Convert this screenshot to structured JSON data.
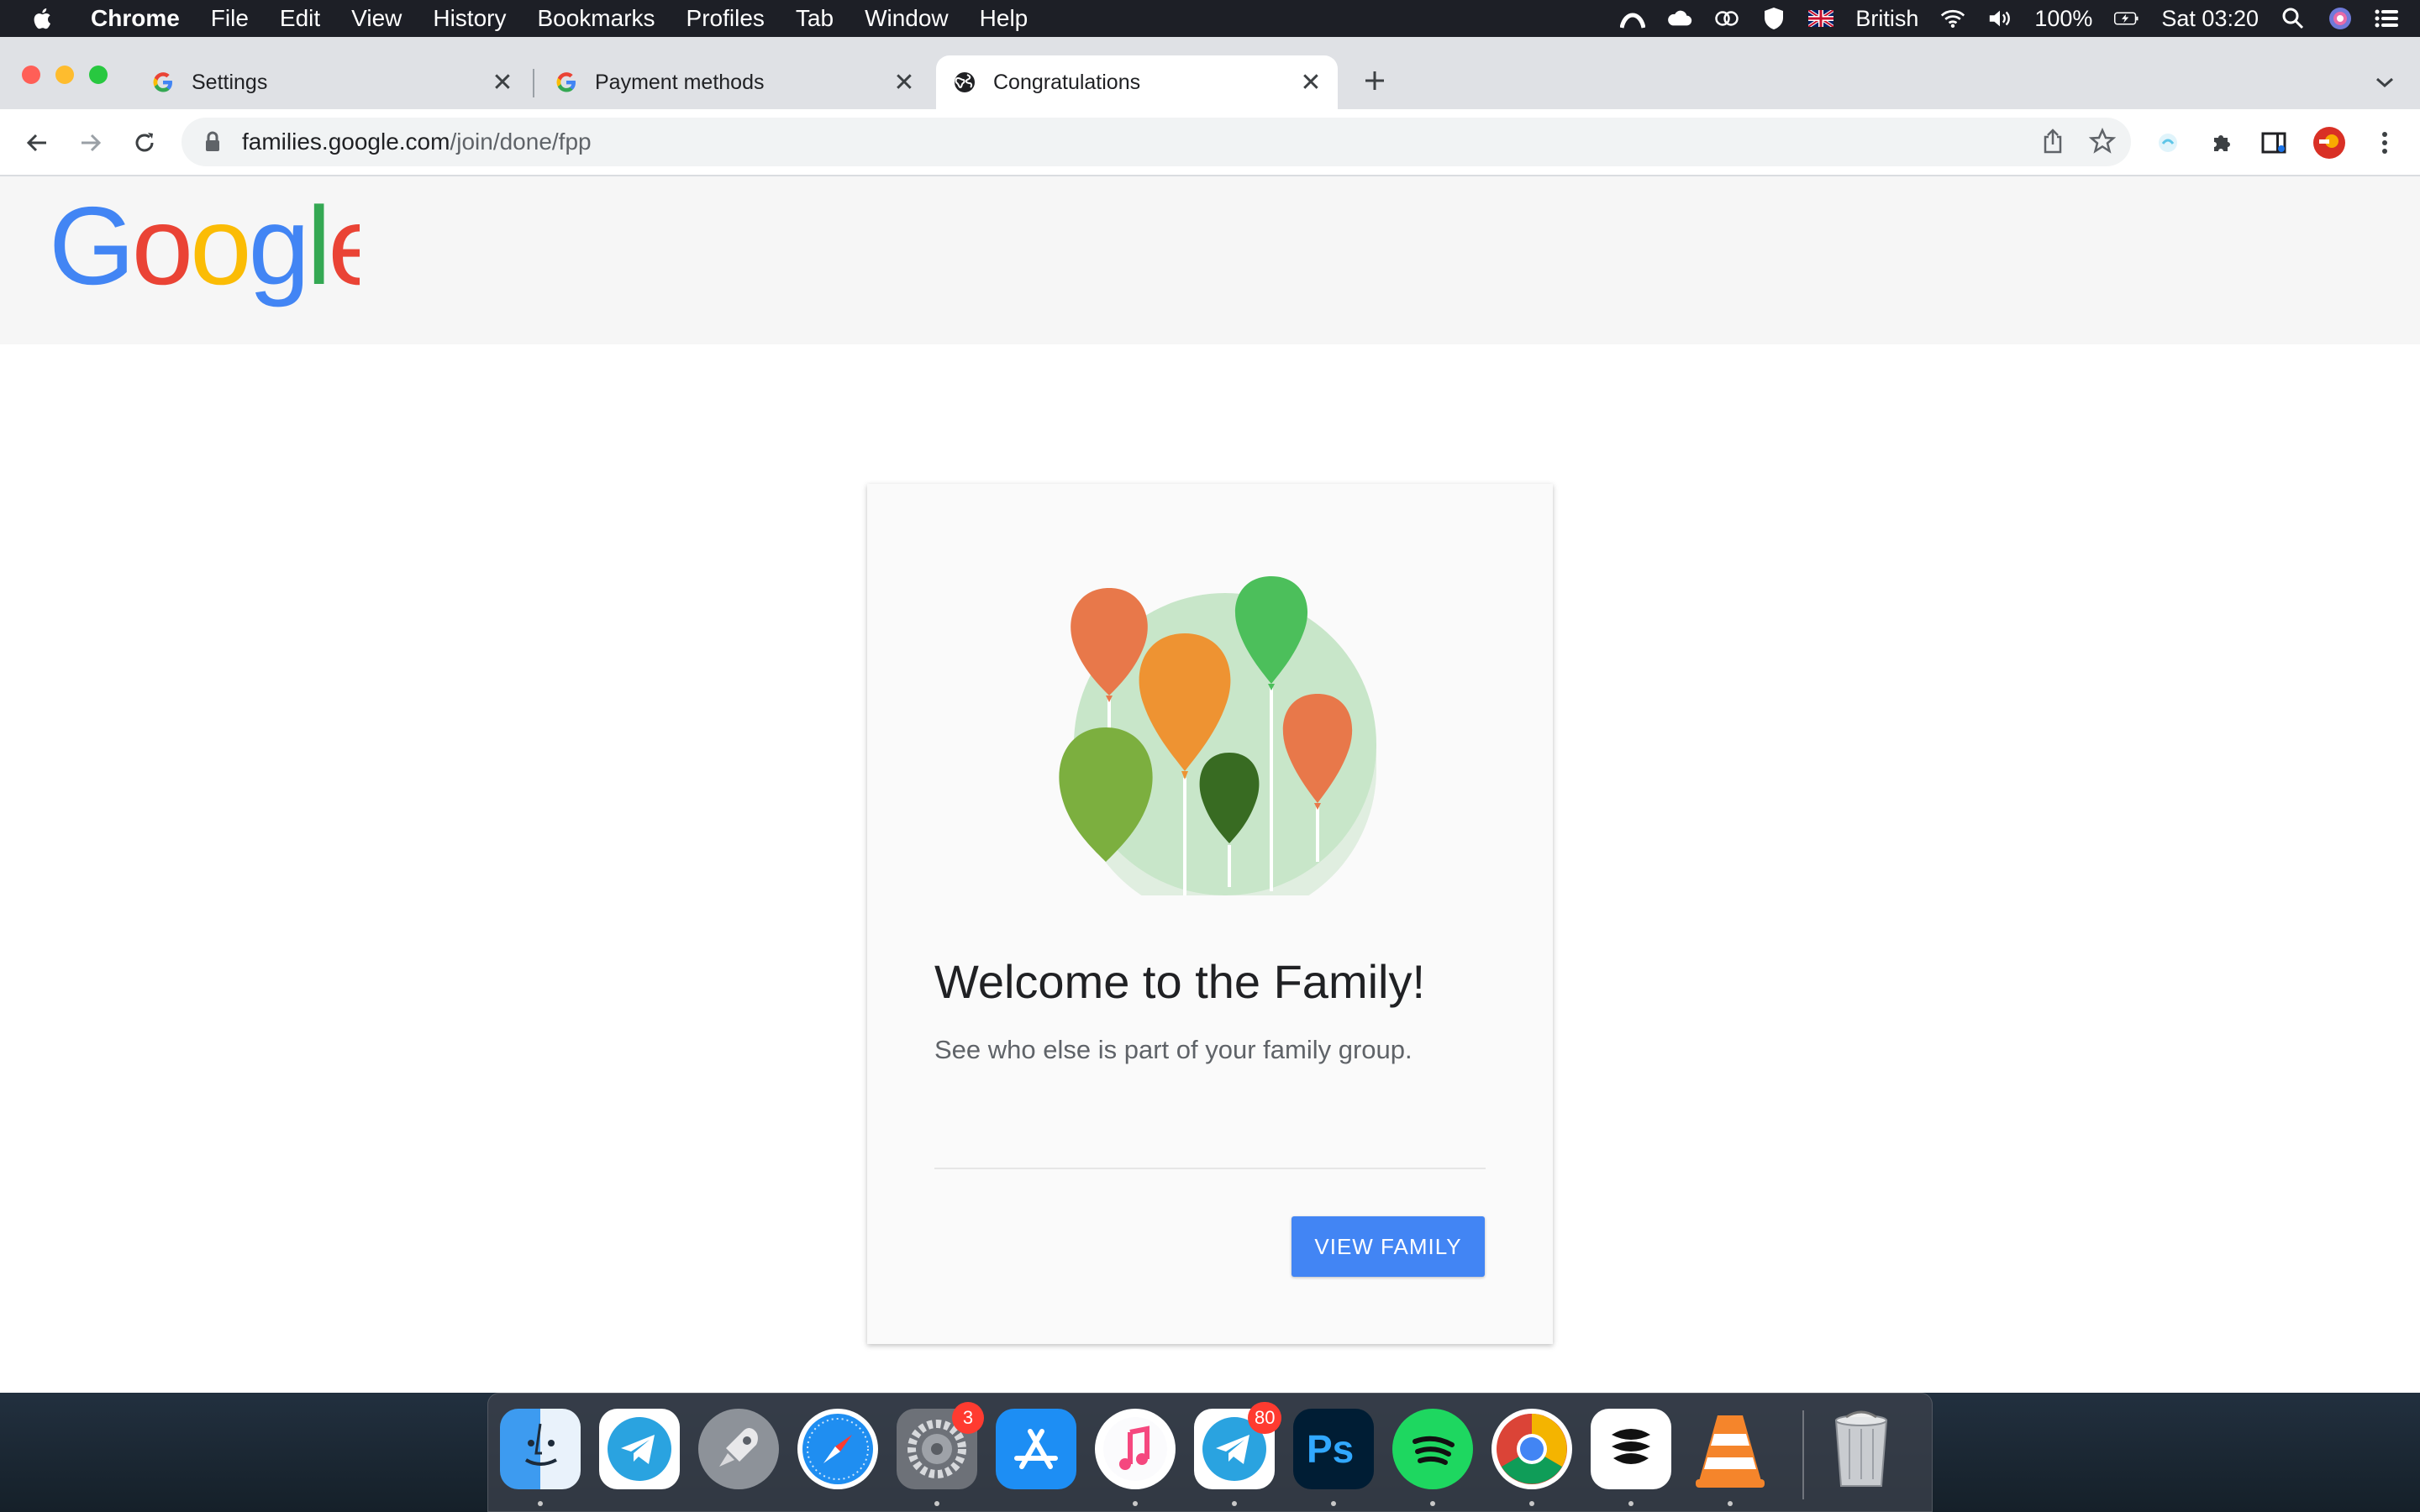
{
  "menubar": {
    "app_name": "Chrome",
    "items": [
      "File",
      "Edit",
      "View",
      "History",
      "Bookmarks",
      "Profiles",
      "Tab",
      "Window",
      "Help"
    ],
    "input_source": "British",
    "battery": "100%",
    "clock": "Sat 03:20"
  },
  "tabs": [
    {
      "label": "Settings",
      "icon": "google-g-icon"
    },
    {
      "label": "Payment methods",
      "icon": "google-g-icon"
    },
    {
      "label": "Congratulations",
      "icon": "globe-icon",
      "active": true
    }
  ],
  "omnibox": {
    "host": "families.google.com",
    "path": "/join/done/fpp"
  },
  "page": {
    "logo": "Google",
    "title": "Welcome to the Family!",
    "subtitle": "See who else is part of your family group.",
    "button_label": "VIEW FAMILY"
  },
  "dock": {
    "apps": [
      {
        "name": "Finder"
      },
      {
        "name": "Telegram"
      },
      {
        "name": "Launchpad"
      },
      {
        "name": "Safari"
      },
      {
        "name": "System Preferences",
        "badge": "3"
      },
      {
        "name": "App Store"
      },
      {
        "name": "Music"
      },
      {
        "name": "Telegram",
        "badge": "80"
      },
      {
        "name": "Photoshop"
      },
      {
        "name": "Spotify"
      },
      {
        "name": "Chrome"
      },
      {
        "name": "Unknown app"
      },
      {
        "name": "VLC"
      },
      {
        "name": "Trash"
      }
    ]
  },
  "colors": {
    "accent_blue": "#4285f4",
    "google_red": "#ea4335",
    "google_yellow": "#fbbc05",
    "google_green": "#34a853"
  }
}
